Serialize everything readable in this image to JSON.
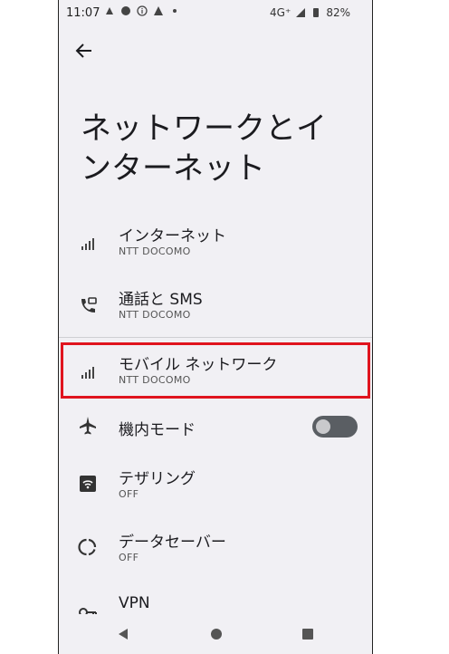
{
  "status_bar": {
    "time": "11:07",
    "network": "4G⁺",
    "battery": "82%"
  },
  "page": {
    "title": "ネットワークとインターネット"
  },
  "items": [
    {
      "label": "インターネット",
      "sub": "NTT DOCOMO",
      "icon": "signal-icon"
    },
    {
      "label": "通話と SMS",
      "sub": "NTT DOCOMO",
      "icon": "phone-sms-icon"
    },
    {
      "label": "モバイル ネットワーク",
      "sub": "NTT DOCOMO",
      "icon": "signal-icon"
    },
    {
      "label": "機内モード",
      "sub": "",
      "icon": "airplane-icon",
      "toggle": "off"
    },
    {
      "label": "テザリング",
      "sub": "OFF",
      "icon": "hotspot-icon"
    },
    {
      "label": "データセーバー",
      "sub": "OFF",
      "icon": "data-saver-icon"
    },
    {
      "label": "VPN",
      "sub": "",
      "icon": "vpn-key-icon"
    }
  ],
  "colors": {
    "background": "#f1f0f4",
    "highlight": "#e0141e",
    "text": "#1b1b1f"
  }
}
